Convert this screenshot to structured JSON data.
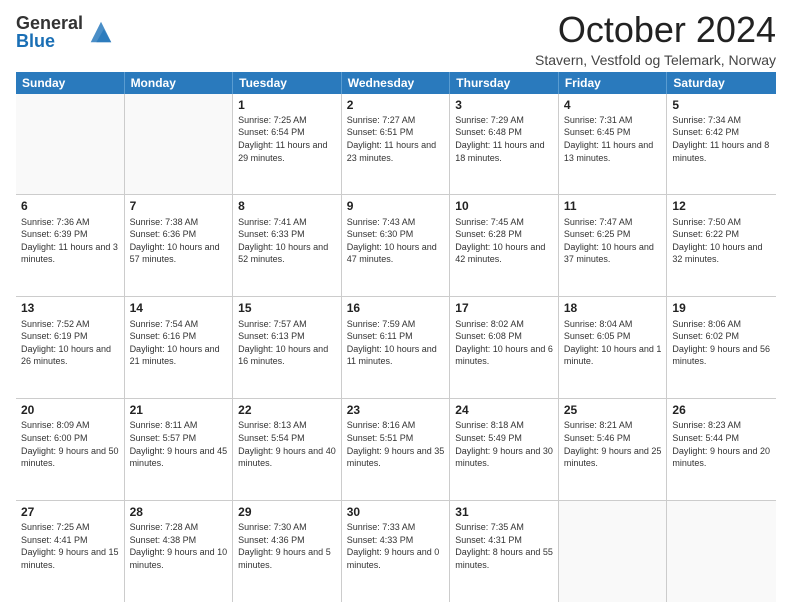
{
  "logo": {
    "general": "General",
    "blue": "Blue"
  },
  "title": "October 2024",
  "subtitle": "Stavern, Vestfold og Telemark, Norway",
  "header_days": [
    "Sunday",
    "Monday",
    "Tuesday",
    "Wednesday",
    "Thursday",
    "Friday",
    "Saturday"
  ],
  "weeks": [
    [
      {
        "day": "",
        "sunrise": "",
        "sunset": "",
        "daylight": ""
      },
      {
        "day": "",
        "sunrise": "",
        "sunset": "",
        "daylight": ""
      },
      {
        "day": "1",
        "sunrise": "Sunrise: 7:25 AM",
        "sunset": "Sunset: 6:54 PM",
        "daylight": "Daylight: 11 hours and 29 minutes."
      },
      {
        "day": "2",
        "sunrise": "Sunrise: 7:27 AM",
        "sunset": "Sunset: 6:51 PM",
        "daylight": "Daylight: 11 hours and 23 minutes."
      },
      {
        "day": "3",
        "sunrise": "Sunrise: 7:29 AM",
        "sunset": "Sunset: 6:48 PM",
        "daylight": "Daylight: 11 hours and 18 minutes."
      },
      {
        "day": "4",
        "sunrise": "Sunrise: 7:31 AM",
        "sunset": "Sunset: 6:45 PM",
        "daylight": "Daylight: 11 hours and 13 minutes."
      },
      {
        "day": "5",
        "sunrise": "Sunrise: 7:34 AM",
        "sunset": "Sunset: 6:42 PM",
        "daylight": "Daylight: 11 hours and 8 minutes."
      }
    ],
    [
      {
        "day": "6",
        "sunrise": "Sunrise: 7:36 AM",
        "sunset": "Sunset: 6:39 PM",
        "daylight": "Daylight: 11 hours and 3 minutes."
      },
      {
        "day": "7",
        "sunrise": "Sunrise: 7:38 AM",
        "sunset": "Sunset: 6:36 PM",
        "daylight": "Daylight: 10 hours and 57 minutes."
      },
      {
        "day": "8",
        "sunrise": "Sunrise: 7:41 AM",
        "sunset": "Sunset: 6:33 PM",
        "daylight": "Daylight: 10 hours and 52 minutes."
      },
      {
        "day": "9",
        "sunrise": "Sunrise: 7:43 AM",
        "sunset": "Sunset: 6:30 PM",
        "daylight": "Daylight: 10 hours and 47 minutes."
      },
      {
        "day": "10",
        "sunrise": "Sunrise: 7:45 AM",
        "sunset": "Sunset: 6:28 PM",
        "daylight": "Daylight: 10 hours and 42 minutes."
      },
      {
        "day": "11",
        "sunrise": "Sunrise: 7:47 AM",
        "sunset": "Sunset: 6:25 PM",
        "daylight": "Daylight: 10 hours and 37 minutes."
      },
      {
        "day": "12",
        "sunrise": "Sunrise: 7:50 AM",
        "sunset": "Sunset: 6:22 PM",
        "daylight": "Daylight: 10 hours and 32 minutes."
      }
    ],
    [
      {
        "day": "13",
        "sunrise": "Sunrise: 7:52 AM",
        "sunset": "Sunset: 6:19 PM",
        "daylight": "Daylight: 10 hours and 26 minutes."
      },
      {
        "day": "14",
        "sunrise": "Sunrise: 7:54 AM",
        "sunset": "Sunset: 6:16 PM",
        "daylight": "Daylight: 10 hours and 21 minutes."
      },
      {
        "day": "15",
        "sunrise": "Sunrise: 7:57 AM",
        "sunset": "Sunset: 6:13 PM",
        "daylight": "Daylight: 10 hours and 16 minutes."
      },
      {
        "day": "16",
        "sunrise": "Sunrise: 7:59 AM",
        "sunset": "Sunset: 6:11 PM",
        "daylight": "Daylight: 10 hours and 11 minutes."
      },
      {
        "day": "17",
        "sunrise": "Sunrise: 8:02 AM",
        "sunset": "Sunset: 6:08 PM",
        "daylight": "Daylight: 10 hours and 6 minutes."
      },
      {
        "day": "18",
        "sunrise": "Sunrise: 8:04 AM",
        "sunset": "Sunset: 6:05 PM",
        "daylight": "Daylight: 10 hours and 1 minute."
      },
      {
        "day": "19",
        "sunrise": "Sunrise: 8:06 AM",
        "sunset": "Sunset: 6:02 PM",
        "daylight": "Daylight: 9 hours and 56 minutes."
      }
    ],
    [
      {
        "day": "20",
        "sunrise": "Sunrise: 8:09 AM",
        "sunset": "Sunset: 6:00 PM",
        "daylight": "Daylight: 9 hours and 50 minutes."
      },
      {
        "day": "21",
        "sunrise": "Sunrise: 8:11 AM",
        "sunset": "Sunset: 5:57 PM",
        "daylight": "Daylight: 9 hours and 45 minutes."
      },
      {
        "day": "22",
        "sunrise": "Sunrise: 8:13 AM",
        "sunset": "Sunset: 5:54 PM",
        "daylight": "Daylight: 9 hours and 40 minutes."
      },
      {
        "day": "23",
        "sunrise": "Sunrise: 8:16 AM",
        "sunset": "Sunset: 5:51 PM",
        "daylight": "Daylight: 9 hours and 35 minutes."
      },
      {
        "day": "24",
        "sunrise": "Sunrise: 8:18 AM",
        "sunset": "Sunset: 5:49 PM",
        "daylight": "Daylight: 9 hours and 30 minutes."
      },
      {
        "day": "25",
        "sunrise": "Sunrise: 8:21 AM",
        "sunset": "Sunset: 5:46 PM",
        "daylight": "Daylight: 9 hours and 25 minutes."
      },
      {
        "day": "26",
        "sunrise": "Sunrise: 8:23 AM",
        "sunset": "Sunset: 5:44 PM",
        "daylight": "Daylight: 9 hours and 20 minutes."
      }
    ],
    [
      {
        "day": "27",
        "sunrise": "Sunrise: 7:25 AM",
        "sunset": "Sunset: 4:41 PM",
        "daylight": "Daylight: 9 hours and 15 minutes."
      },
      {
        "day": "28",
        "sunrise": "Sunrise: 7:28 AM",
        "sunset": "Sunset: 4:38 PM",
        "daylight": "Daylight: 9 hours and 10 minutes."
      },
      {
        "day": "29",
        "sunrise": "Sunrise: 7:30 AM",
        "sunset": "Sunset: 4:36 PM",
        "daylight": "Daylight: 9 hours and 5 minutes."
      },
      {
        "day": "30",
        "sunrise": "Sunrise: 7:33 AM",
        "sunset": "Sunset: 4:33 PM",
        "daylight": "Daylight: 9 hours and 0 minutes."
      },
      {
        "day": "31",
        "sunrise": "Sunrise: 7:35 AM",
        "sunset": "Sunset: 4:31 PM",
        "daylight": "Daylight: 8 hours and 55 minutes."
      },
      {
        "day": "",
        "sunrise": "",
        "sunset": "",
        "daylight": ""
      },
      {
        "day": "",
        "sunrise": "",
        "sunset": "",
        "daylight": ""
      }
    ]
  ]
}
